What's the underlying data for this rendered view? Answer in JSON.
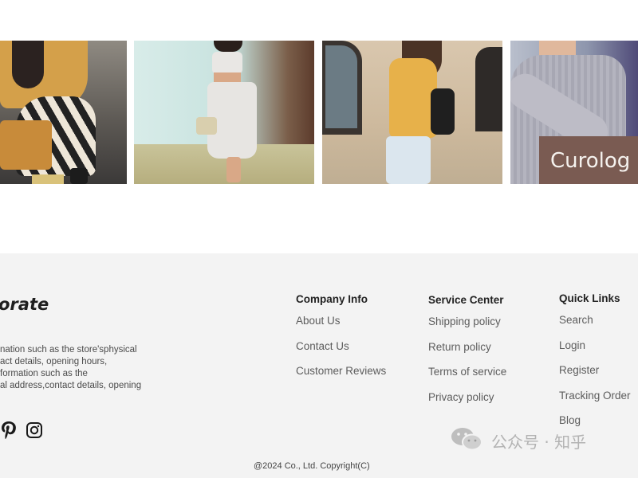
{
  "gallery": {
    "photos": [
      {
        "alt": "woman crouching with tan handbag"
      },
      {
        "alt": "woman in white outfit holding bag"
      },
      {
        "alt": "woman walking with black backpack"
      },
      {
        "alt": "person holding printed tote bag"
      }
    ],
    "tote_print": "Curolog"
  },
  "footer": {
    "brand": "orate",
    "about_lines": [
      "nation such as the store'sphysical",
      "act details, opening hours,",
      "formation such as the",
      "al address,contact details, opening"
    ],
    "social": [
      {
        "icon": "pinterest-icon"
      },
      {
        "icon": "instagram-icon"
      }
    ],
    "company": {
      "heading": "Company Info",
      "links": [
        "About Us",
        "Contact Us",
        "Customer Reviews"
      ]
    },
    "service": {
      "heading": "Service Center",
      "links": [
        "Shipping policy",
        "Return policy",
        "Terms of service",
        "Privacy policy"
      ]
    },
    "quick": {
      "heading": "Quick Links",
      "links": [
        "Search",
        "Login",
        "Register",
        "Tracking Order",
        "Blog"
      ]
    },
    "copyright": "@2024  Co., Ltd.  Copyright(C)"
  },
  "watermark": {
    "text": "公众号 · 知乎",
    "icon": "wechat-icon"
  },
  "colors": {
    "footer_bg": "#f3f3f3",
    "heading": "#222222",
    "link": "#5c5c5c"
  }
}
